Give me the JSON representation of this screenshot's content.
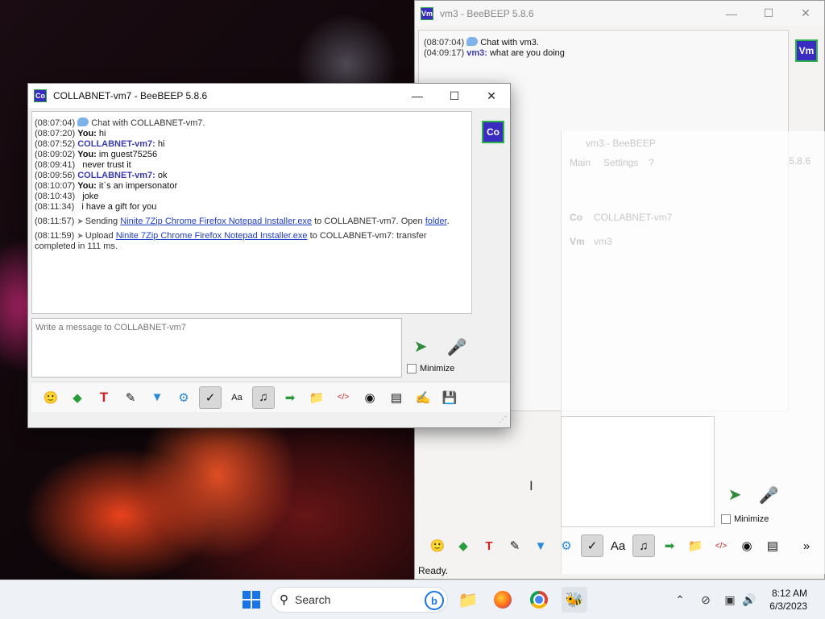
{
  "background_window": {
    "title": "vm3 - BeeBEEP 5.8.6",
    "icon_label": "Vm",
    "messages": [
      {
        "time": "(08:07:04)",
        "text": "Chat with vm3."
      },
      {
        "time": "(04:09:17)",
        "sender": "vm3:",
        "text": " what are you doing"
      }
    ],
    "side_badge": "Vm",
    "overlay": {
      "title": "vm3 - BeeBEEP",
      "version": "5.8.6",
      "menu": [
        "Main",
        "Settings",
        "?"
      ],
      "users": [
        {
          "badge": "Co",
          "name": "COLLABNET-vm7"
        },
        {
          "badge": "Vm",
          "name": "vm3"
        }
      ]
    },
    "minimize_label": "Minimize",
    "status": "Ready."
  },
  "foreground_window": {
    "title": "COLLABNET-vm7 - BeeBEEP 5.8.6",
    "icon_label": "Co",
    "side_badge": "Co",
    "messages": {
      "m1_time": "(08:07:04)",
      "m1_text": "Chat with COLLABNET-vm7.",
      "m2_time": "(08:07:20)",
      "m2_sender": "You:",
      "m2_text": " hi",
      "m3_time": "(08:07:52)",
      "m3_sender": "COLLABNET-vm7:",
      "m3_text": " hi",
      "m4_time": "(08:09:02)",
      "m4_sender": "You:",
      "m4_text": " im guest75256",
      "m5_time": "(08:09:41)",
      "m5_text": "never trust it",
      "m6_time": "(08:09:56)",
      "m6_sender": "COLLABNET-vm7:",
      "m6_text": " ok",
      "m7_time": "(08:10:07)",
      "m7_sender": "You:",
      "m7_text": " it`s an impersonator",
      "m8_time": "(08:10:43)",
      "m8_text": "joke",
      "m9_time": "(08:11:34)",
      "m9_text": "i have a gift for you",
      "m10_time": "(08:11:57)",
      "m10_pre": "Sending ",
      "m10_link": "Ninite 7Zip Chrome Firefox Notepad Installer.exe",
      "m10_mid": " to COLLABNET-vm7. Open ",
      "m10_link2": "folder",
      "m10_post": ".",
      "m11_time": "(08:11:59)",
      "m11_pre": "Upload ",
      "m11_link": "Ninite 7Zip Chrome Firefox Notepad Installer.exe",
      "m11_post": " to COLLABNET-vm7: transfer",
      "m11_cont": "completed in 111 ms."
    },
    "input_placeholder": "Write a message to COLLABNET-vm7",
    "minimize_label": "Minimize"
  },
  "taskbar": {
    "search_label": "Search",
    "time": "8:12 AM",
    "date": "6/3/2023"
  },
  "colors": {
    "peer_name": "#3b3bb0",
    "link": "#1f3cc4",
    "badge_bg": "#3a2cc0",
    "badge_border": "#2bb24a"
  }
}
